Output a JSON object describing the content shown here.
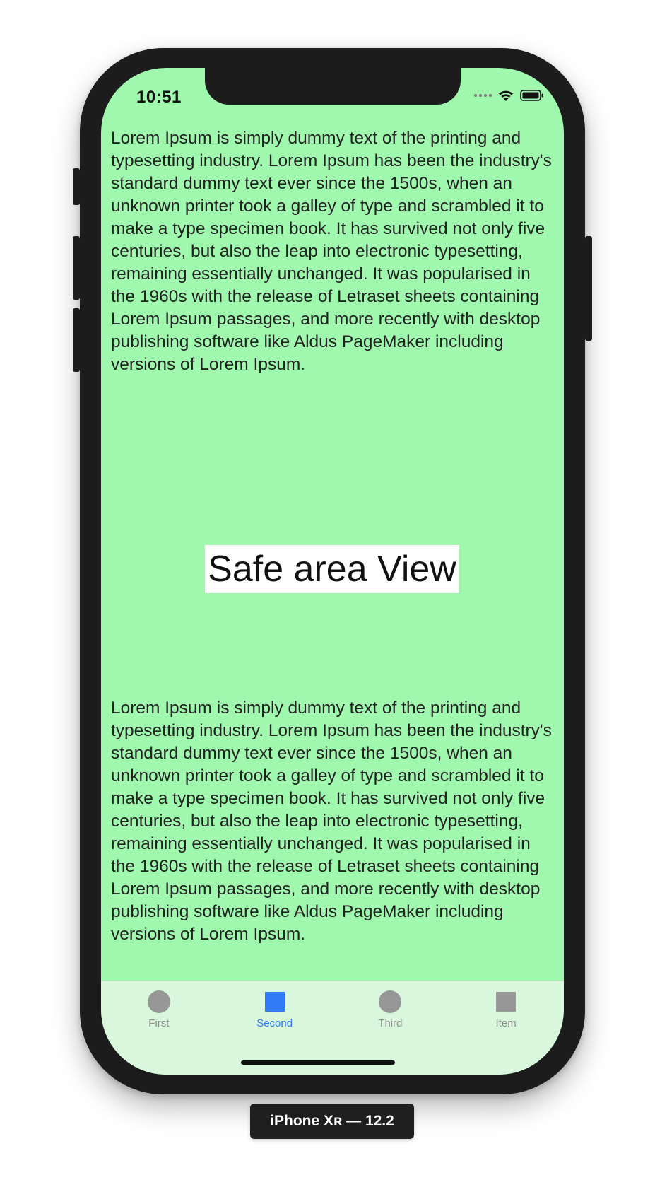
{
  "status_bar": {
    "time": "10:51",
    "signal_icon": "signal-dots-icon",
    "wifi_icon": "wifi-icon",
    "battery_icon": "battery-icon"
  },
  "content": {
    "top_paragraph": "Lorem Ipsum is simply dummy text of the printing and typesetting industry. Lorem Ipsum has been the industry's standard dummy text ever since the 1500s, when an unknown printer took a galley of type and scrambled it to make a type specimen book. It has survived not only five centuries, but also the leap into electronic typesetting, remaining essentially unchanged. It was popularised in the 1960s with the release of Letraset sheets containing Lorem Ipsum passages, and more recently with desktop publishing software like Aldus PageMaker including versions of Lorem Ipsum.",
    "center_label": "Safe area View",
    "bottom_paragraph": "Lorem Ipsum is simply dummy text of the printing and typesetting industry. Lorem Ipsum has been the industry's standard dummy text ever since the 1500s, when an unknown printer took a galley of type and scrambled it to make a type specimen book. It has survived not only five centuries, but also the leap into electronic typesetting, remaining essentially unchanged. It was popularised in the 1960s with the release of Letraset sheets containing Lorem Ipsum passages, and more recently with desktop publishing software like Aldus PageMaker including versions of Lorem Ipsum."
  },
  "tab_bar": {
    "tabs": [
      {
        "label": "First",
        "icon": "circle-icon",
        "selected": false
      },
      {
        "label": "Second",
        "icon": "square-icon",
        "selected": true
      },
      {
        "label": "Third",
        "icon": "circle-icon",
        "selected": false
      },
      {
        "label": "Item",
        "icon": "square-icon",
        "selected": false
      }
    ]
  },
  "device": {
    "label": "iPhone Xʀ — 12.2"
  },
  "colors": {
    "screen_background": "#a0f8ae",
    "tab_bar_background": "#d8f7dd",
    "active_tint": "#2f7cf6",
    "inactive_tint": "#8e8e8e",
    "device_frame": "#1c1c1c"
  }
}
